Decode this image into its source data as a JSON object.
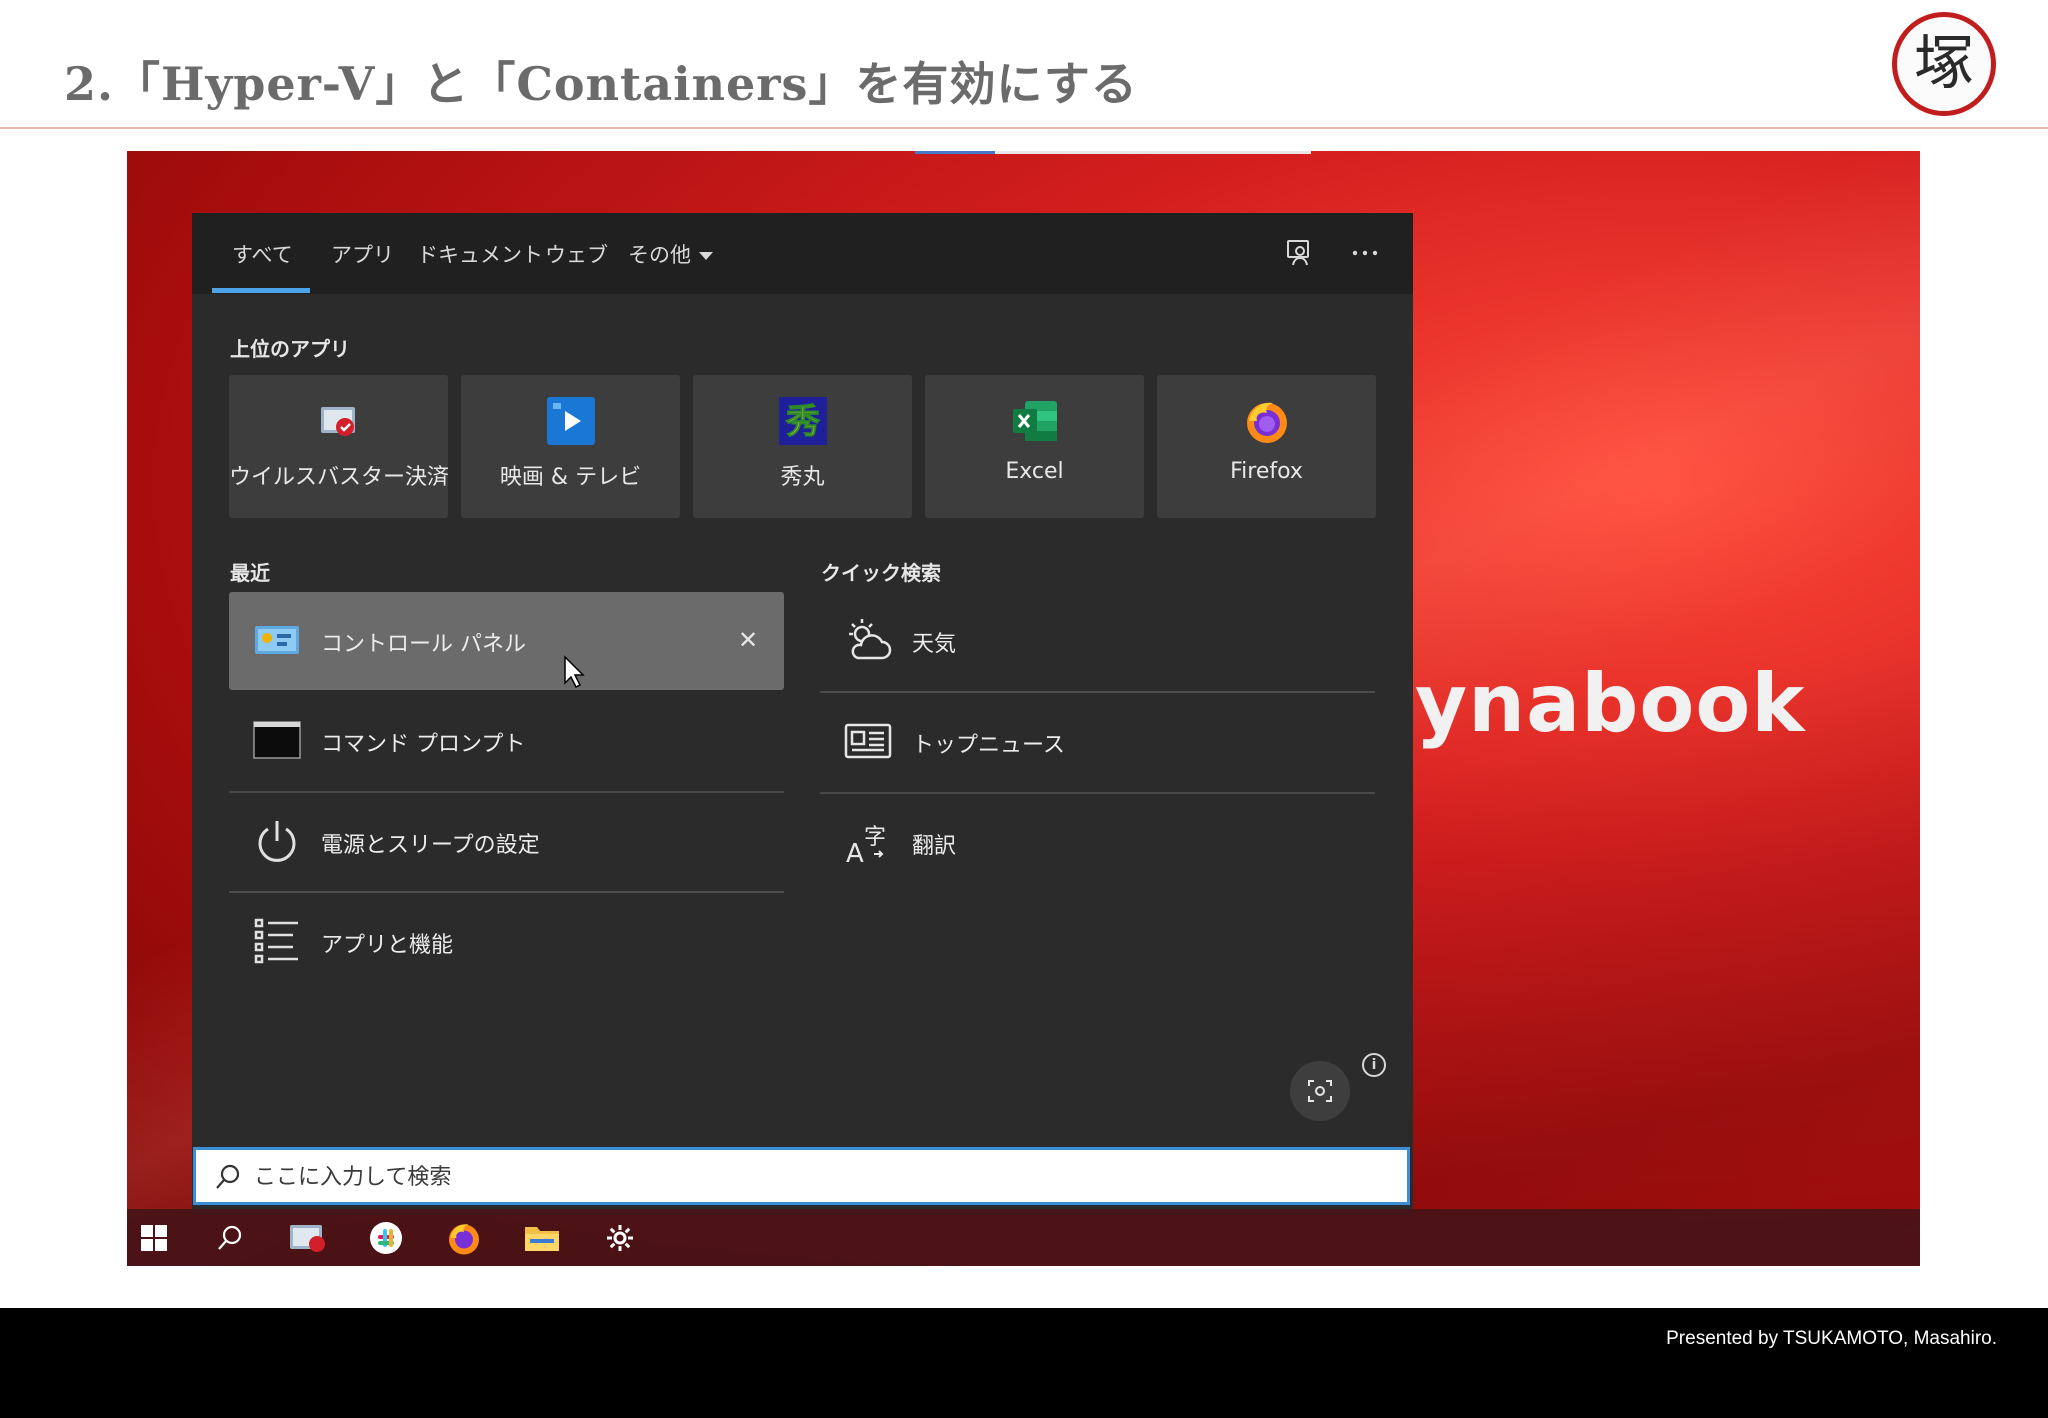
{
  "slide": {
    "title": "2.「Hyper-V」と「Containers」を有効にする",
    "logo_char": "塚",
    "footer": "Presented by TSUKAMOTO, Masahiro."
  },
  "screenshot": {
    "brand_text": "ynabook",
    "tabs": [
      {
        "label": "すべて",
        "active": true
      },
      {
        "label": "アプリ"
      },
      {
        "label": "ドキュメント"
      },
      {
        "label": "ウェブ"
      },
      {
        "label": "その他"
      }
    ],
    "header_icons": [
      "feedback-icon",
      "more-options-icon"
    ],
    "top_apps_label": "上位のアプリ",
    "top_apps": [
      {
        "label": "ウイルスバスター決済...",
        "icon": "virusbuster-icon"
      },
      {
        "label": "映画 & テレビ",
        "icon": "movies-tv-icon"
      },
      {
        "label": "秀丸",
        "icon": "hidemaru-icon"
      },
      {
        "label": "Excel",
        "icon": "excel-icon"
      },
      {
        "label": "Firefox",
        "icon": "firefox-icon"
      }
    ],
    "recent_label": "最近",
    "recent": [
      {
        "label": "コントロール パネル",
        "icon": "control-panel-icon",
        "highlighted": true
      },
      {
        "label": "コマンド プロンプト",
        "icon": "command-prompt-icon"
      },
      {
        "label": "電源とスリープの設定",
        "icon": "power-icon"
      },
      {
        "label": "アプリと機能",
        "icon": "apps-features-icon"
      }
    ],
    "quick_label": "クイック検索",
    "quick": [
      {
        "label": "天気",
        "icon": "weather-icon"
      },
      {
        "label": "トップニュース",
        "icon": "news-icon"
      },
      {
        "label": "翻訳",
        "icon": "translate-icon"
      }
    ],
    "search": {
      "placeholder": "ここに入力して検索",
      "value": ""
    },
    "taskbar_icons": [
      "windows-start-icon",
      "search-icon",
      "virusbuster-icon",
      "slack-icon",
      "firefox-icon",
      "file-explorer-icon",
      "settings-gear-icon"
    ],
    "colors": {
      "accent": "#4ca3e8",
      "panel": "#2b2b2b",
      "tile": "#3d3d3d",
      "highlight": "#6b6b6b",
      "logo_ring": "#c21d1d"
    }
  }
}
